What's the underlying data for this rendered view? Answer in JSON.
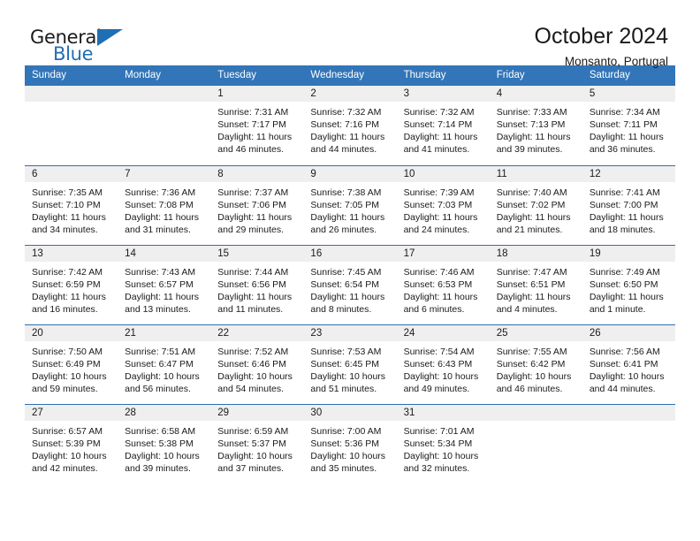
{
  "logo": {
    "text_primary": "General",
    "text_secondary": "Blue",
    "triangle_icon": "triangle-icon",
    "accent_color": "#1f6fb4"
  },
  "header": {
    "title": "October 2024",
    "subtitle": "Monsanto, Portugal"
  },
  "calendar": {
    "header_bg": "#3275b8",
    "daynum_bg": "#efefef",
    "weekday_headers": [
      "Sunday",
      "Monday",
      "Tuesday",
      "Wednesday",
      "Thursday",
      "Friday",
      "Saturday"
    ],
    "weeks": [
      [
        {
          "day": "",
          "empty": true
        },
        {
          "day": "",
          "empty": true
        },
        {
          "day": "1",
          "sunrise": "Sunrise: 7:31 AM",
          "sunset": "Sunset: 7:17 PM",
          "daylight": "Daylight: 11 hours and 46 minutes."
        },
        {
          "day": "2",
          "sunrise": "Sunrise: 7:32 AM",
          "sunset": "Sunset: 7:16 PM",
          "daylight": "Daylight: 11 hours and 44 minutes."
        },
        {
          "day": "3",
          "sunrise": "Sunrise: 7:32 AM",
          "sunset": "Sunset: 7:14 PM",
          "daylight": "Daylight: 11 hours and 41 minutes."
        },
        {
          "day": "4",
          "sunrise": "Sunrise: 7:33 AM",
          "sunset": "Sunset: 7:13 PM",
          "daylight": "Daylight: 11 hours and 39 minutes."
        },
        {
          "day": "5",
          "sunrise": "Sunrise: 7:34 AM",
          "sunset": "Sunset: 7:11 PM",
          "daylight": "Daylight: 11 hours and 36 minutes."
        }
      ],
      [
        {
          "day": "6",
          "sunrise": "Sunrise: 7:35 AM",
          "sunset": "Sunset: 7:10 PM",
          "daylight": "Daylight: 11 hours and 34 minutes."
        },
        {
          "day": "7",
          "sunrise": "Sunrise: 7:36 AM",
          "sunset": "Sunset: 7:08 PM",
          "daylight": "Daylight: 11 hours and 31 minutes."
        },
        {
          "day": "8",
          "sunrise": "Sunrise: 7:37 AM",
          "sunset": "Sunset: 7:06 PM",
          "daylight": "Daylight: 11 hours and 29 minutes."
        },
        {
          "day": "9",
          "sunrise": "Sunrise: 7:38 AM",
          "sunset": "Sunset: 7:05 PM",
          "daylight": "Daylight: 11 hours and 26 minutes."
        },
        {
          "day": "10",
          "sunrise": "Sunrise: 7:39 AM",
          "sunset": "Sunset: 7:03 PM",
          "daylight": "Daylight: 11 hours and 24 minutes."
        },
        {
          "day": "11",
          "sunrise": "Sunrise: 7:40 AM",
          "sunset": "Sunset: 7:02 PM",
          "daylight": "Daylight: 11 hours and 21 minutes."
        },
        {
          "day": "12",
          "sunrise": "Sunrise: 7:41 AM",
          "sunset": "Sunset: 7:00 PM",
          "daylight": "Daylight: 11 hours and 18 minutes."
        }
      ],
      [
        {
          "day": "13",
          "sunrise": "Sunrise: 7:42 AM",
          "sunset": "Sunset: 6:59 PM",
          "daylight": "Daylight: 11 hours and 16 minutes."
        },
        {
          "day": "14",
          "sunrise": "Sunrise: 7:43 AM",
          "sunset": "Sunset: 6:57 PM",
          "daylight": "Daylight: 11 hours and 13 minutes."
        },
        {
          "day": "15",
          "sunrise": "Sunrise: 7:44 AM",
          "sunset": "Sunset: 6:56 PM",
          "daylight": "Daylight: 11 hours and 11 minutes."
        },
        {
          "day": "16",
          "sunrise": "Sunrise: 7:45 AM",
          "sunset": "Sunset: 6:54 PM",
          "daylight": "Daylight: 11 hours and 8 minutes."
        },
        {
          "day": "17",
          "sunrise": "Sunrise: 7:46 AM",
          "sunset": "Sunset: 6:53 PM",
          "daylight": "Daylight: 11 hours and 6 minutes."
        },
        {
          "day": "18",
          "sunrise": "Sunrise: 7:47 AM",
          "sunset": "Sunset: 6:51 PM",
          "daylight": "Daylight: 11 hours and 4 minutes."
        },
        {
          "day": "19",
          "sunrise": "Sunrise: 7:49 AM",
          "sunset": "Sunset: 6:50 PM",
          "daylight": "Daylight: 11 hours and 1 minute."
        }
      ],
      [
        {
          "day": "20",
          "sunrise": "Sunrise: 7:50 AM",
          "sunset": "Sunset: 6:49 PM",
          "daylight": "Daylight: 10 hours and 59 minutes."
        },
        {
          "day": "21",
          "sunrise": "Sunrise: 7:51 AM",
          "sunset": "Sunset: 6:47 PM",
          "daylight": "Daylight: 10 hours and 56 minutes."
        },
        {
          "day": "22",
          "sunrise": "Sunrise: 7:52 AM",
          "sunset": "Sunset: 6:46 PM",
          "daylight": "Daylight: 10 hours and 54 minutes."
        },
        {
          "day": "23",
          "sunrise": "Sunrise: 7:53 AM",
          "sunset": "Sunset: 6:45 PM",
          "daylight": "Daylight: 10 hours and 51 minutes."
        },
        {
          "day": "24",
          "sunrise": "Sunrise: 7:54 AM",
          "sunset": "Sunset: 6:43 PM",
          "daylight": "Daylight: 10 hours and 49 minutes."
        },
        {
          "day": "25",
          "sunrise": "Sunrise: 7:55 AM",
          "sunset": "Sunset: 6:42 PM",
          "daylight": "Daylight: 10 hours and 46 minutes."
        },
        {
          "day": "26",
          "sunrise": "Sunrise: 7:56 AM",
          "sunset": "Sunset: 6:41 PM",
          "daylight": "Daylight: 10 hours and 44 minutes."
        }
      ],
      [
        {
          "day": "27",
          "sunrise": "Sunrise: 6:57 AM",
          "sunset": "Sunset: 5:39 PM",
          "daylight": "Daylight: 10 hours and 42 minutes."
        },
        {
          "day": "28",
          "sunrise": "Sunrise: 6:58 AM",
          "sunset": "Sunset: 5:38 PM",
          "daylight": "Daylight: 10 hours and 39 minutes."
        },
        {
          "day": "29",
          "sunrise": "Sunrise: 6:59 AM",
          "sunset": "Sunset: 5:37 PM",
          "daylight": "Daylight: 10 hours and 37 minutes."
        },
        {
          "day": "30",
          "sunrise": "Sunrise: 7:00 AM",
          "sunset": "Sunset: 5:36 PM",
          "daylight": "Daylight: 10 hours and 35 minutes."
        },
        {
          "day": "31",
          "sunrise": "Sunrise: 7:01 AM",
          "sunset": "Sunset: 5:34 PM",
          "daylight": "Daylight: 10 hours and 32 minutes."
        },
        {
          "day": "",
          "empty": true
        },
        {
          "day": "",
          "empty": true
        }
      ]
    ]
  }
}
